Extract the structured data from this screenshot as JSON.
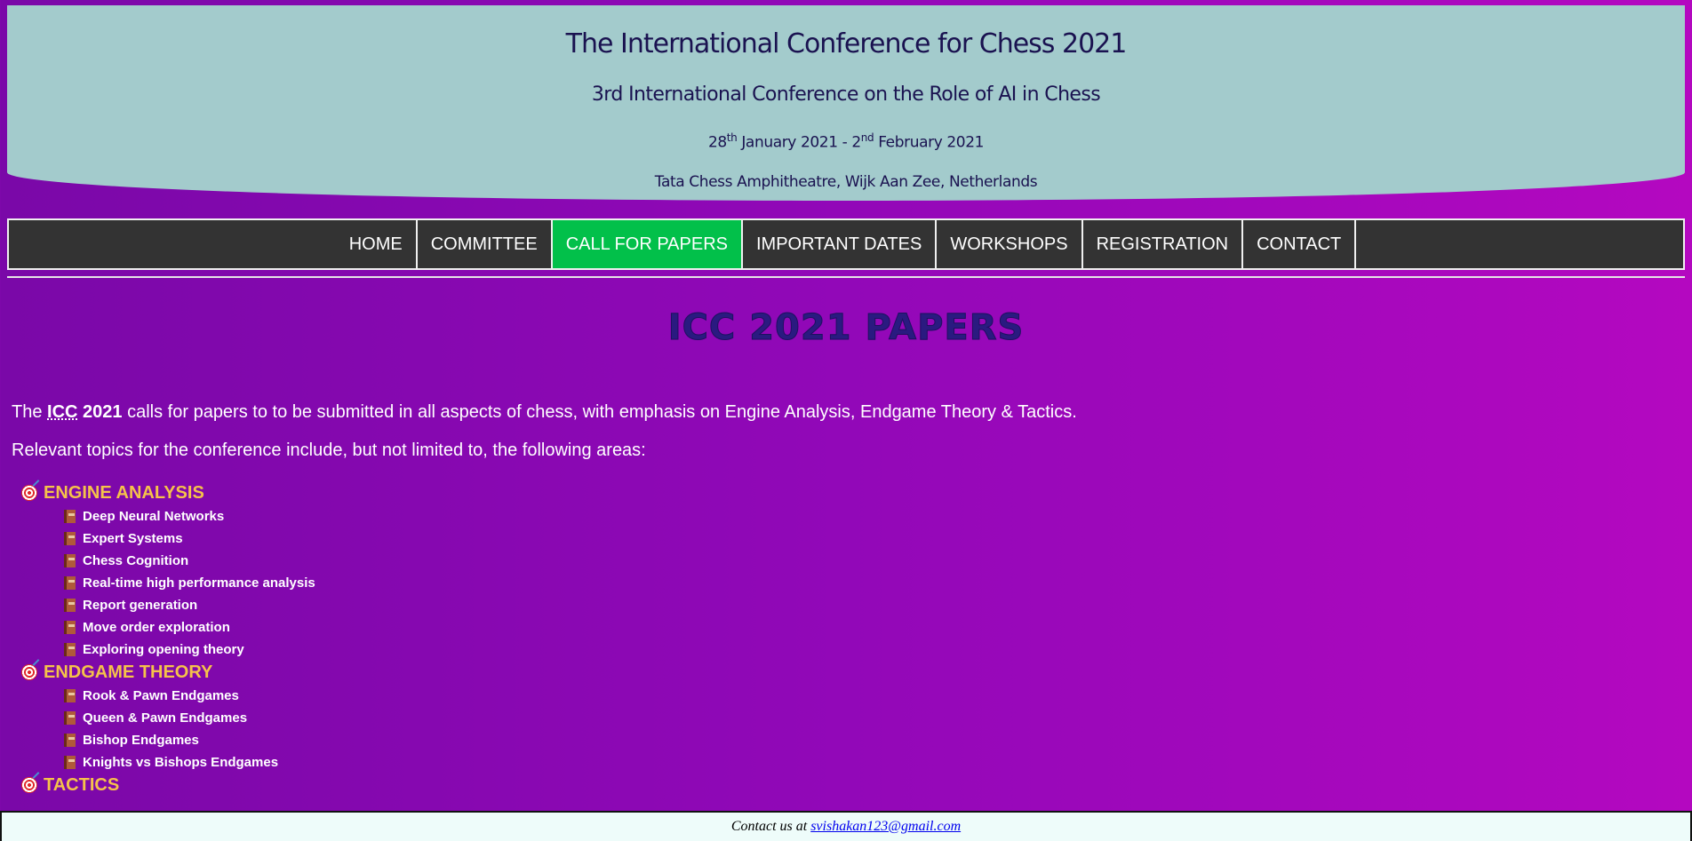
{
  "header": {
    "title": "The International Conference for Chess 2021",
    "subtitle": "3rd International Conference on the Role of AI in Chess",
    "dates": {
      "start_day": "28",
      "start_sup": "th",
      "start_rest": " January 2021 - 2",
      "end_sup": "nd",
      "end_rest": " February 2021"
    },
    "venue": "Tata Chess Amphitheatre, Wijk Aan Zee, Netherlands"
  },
  "nav": {
    "active": "CALL FOR PAPERS",
    "items": [
      {
        "label": "HOME"
      },
      {
        "label": "COMMITTEE"
      },
      {
        "label": "CALL FOR PAPERS"
      },
      {
        "label": "IMPORTANT DATES"
      },
      {
        "label": "WORKSHOPS"
      },
      {
        "label": "REGISTRATION"
      },
      {
        "label": "CONTACT"
      }
    ]
  },
  "main": {
    "page_title": "ICC 2021 PAPERS",
    "intro": {
      "prefix": "The ",
      "abbr": "ICC",
      "year": " 2021",
      "rest": " calls for papers to to be submitted in all aspects of chess, with emphasis on Engine Analysis, Endgame Theory & Tactics."
    },
    "topics_intro": "Relevant topics for the conference include, but not limited to, the following areas:",
    "categories": [
      {
        "title": "ENGINE ANALYSIS",
        "icon": "target-icon",
        "items": [
          "Deep Neural Networks",
          "Expert Systems",
          "Chess Cognition",
          "Real-time high performance analysis",
          "Report generation",
          "Move order exploration",
          "Exploring opening theory"
        ]
      },
      {
        "title": "ENDGAME THEORY",
        "icon": "target-icon",
        "items": [
          "Rook & Pawn Endgames",
          "Queen & Pawn Endgames",
          "Bishop Endgames",
          "Knights vs Bishops Endgames"
        ]
      },
      {
        "title": "TACTICS",
        "icon": "target-icon",
        "items": []
      }
    ],
    "item_icon": "book-icon"
  },
  "footer": {
    "prefix": "Contact us at ",
    "email": "svishakan123@gmail.com"
  },
  "colors": {
    "header_bg": "#a3cbcc",
    "nav_bg": "#333333",
    "nav_active": "#02c04a",
    "category_color": "#f5c24a",
    "title_color": "#2a1a80"
  }
}
